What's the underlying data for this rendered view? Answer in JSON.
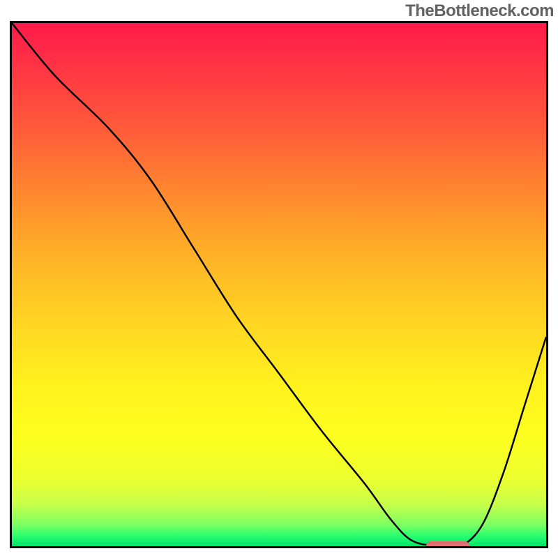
{
  "watermark": "TheBottleneck.com",
  "chart_data": {
    "type": "line",
    "title": "",
    "xlabel": "",
    "ylabel": "",
    "xlim": [
      0,
      100
    ],
    "ylim": [
      0,
      100
    ],
    "x": [
      0,
      8,
      18,
      26,
      34,
      42,
      50,
      58,
      66,
      71,
      75,
      80,
      84,
      88,
      92,
      96,
      100
    ],
    "values": [
      100,
      90,
      80,
      70,
      57,
      44,
      33,
      22,
      12,
      5,
      1,
      0,
      0,
      4,
      14,
      27,
      40
    ],
    "marker": {
      "x_start": 77,
      "x_end": 85,
      "y": 0
    },
    "gradient_colors": {
      "top": "#ff1a4a",
      "mid": "#ffd722",
      "bottom": "#00e46a"
    }
  }
}
